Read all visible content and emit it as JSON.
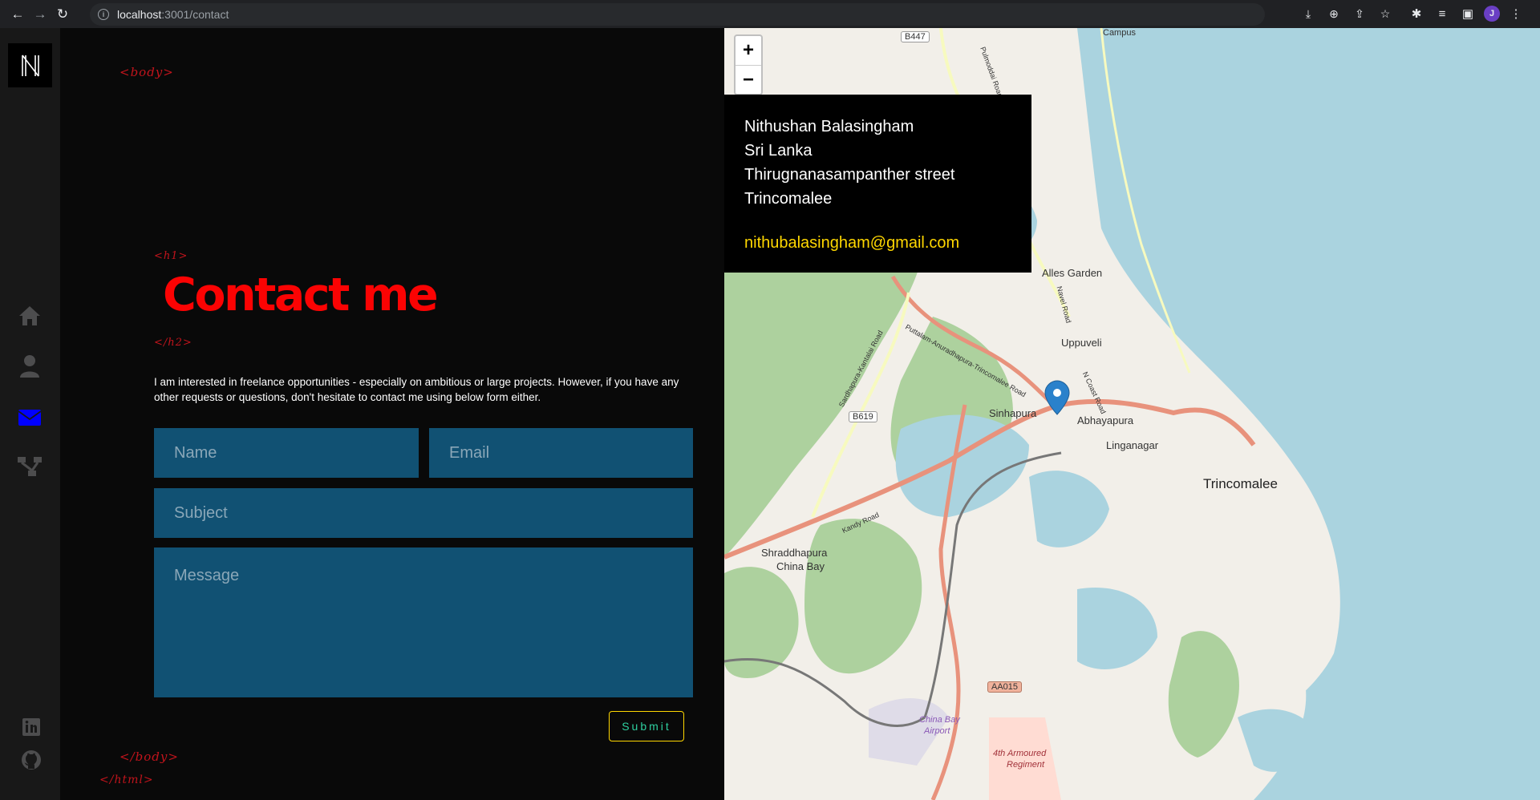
{
  "browser": {
    "url_host": "localhost",
    "url_path": ":3001/contact",
    "avatar_letter": "J"
  },
  "sidebar": {
    "logo_letter": "N",
    "nav_items": [
      "home",
      "about",
      "contact",
      "portfolio"
    ],
    "active_item": "contact",
    "active_color": "#0000ff",
    "social": [
      "linkedin",
      "github"
    ]
  },
  "tags": {
    "body_open": "<body>",
    "h1_open": "<h1>",
    "h2_close": "</h2>",
    "body_close": "</body>",
    "html_close": "</html>"
  },
  "contact": {
    "heading": "Contact me",
    "intro": "I am interested in freelance opportunities - especially on ambitious or large projects. However, if you have any other requests or questions, don't hesitate to contact me using below form either.",
    "name_placeholder": "Name",
    "email_placeholder": "Email",
    "subject_placeholder": "Subject",
    "message_placeholder": "Message",
    "submit_label": "Submit"
  },
  "map": {
    "zoom_in": "+",
    "zoom_out": "−",
    "address": {
      "name": "Nithushan Balasingham",
      "country": "Sri Lanka",
      "street": "Thirugnanasampanther street",
      "city": "Trincomalee",
      "email": "nithubalasingham@gmail.com"
    },
    "labels": {
      "b447": "B447",
      "alles": "Alles Garden",
      "uppuveli": "Uppuveli",
      "sinhapura": "Sinhapura",
      "abhayapura": "Abhayapura",
      "linganagar": "Linganagar",
      "b619": "B619",
      "trinco": "Trincomalee",
      "shradd": "Shraddhapura",
      "chinabay": "China Bay",
      "aa015": "AA015",
      "airport1": "China Bay",
      "airport2": "Airport",
      "reg1": "4th Armoured",
      "reg2": "Regiment",
      "kandy": "Kandy Road",
      "puttalam": "Puttalam-Anuradhapura-Trincomalee Road",
      "sardha": "Sardhapura-Kantalai Road",
      "navel": "Navel Road",
      "ncoast": "N Coast Road",
      "pulmoddai": "Pulmoddai Road",
      "campus": "Campus"
    }
  }
}
